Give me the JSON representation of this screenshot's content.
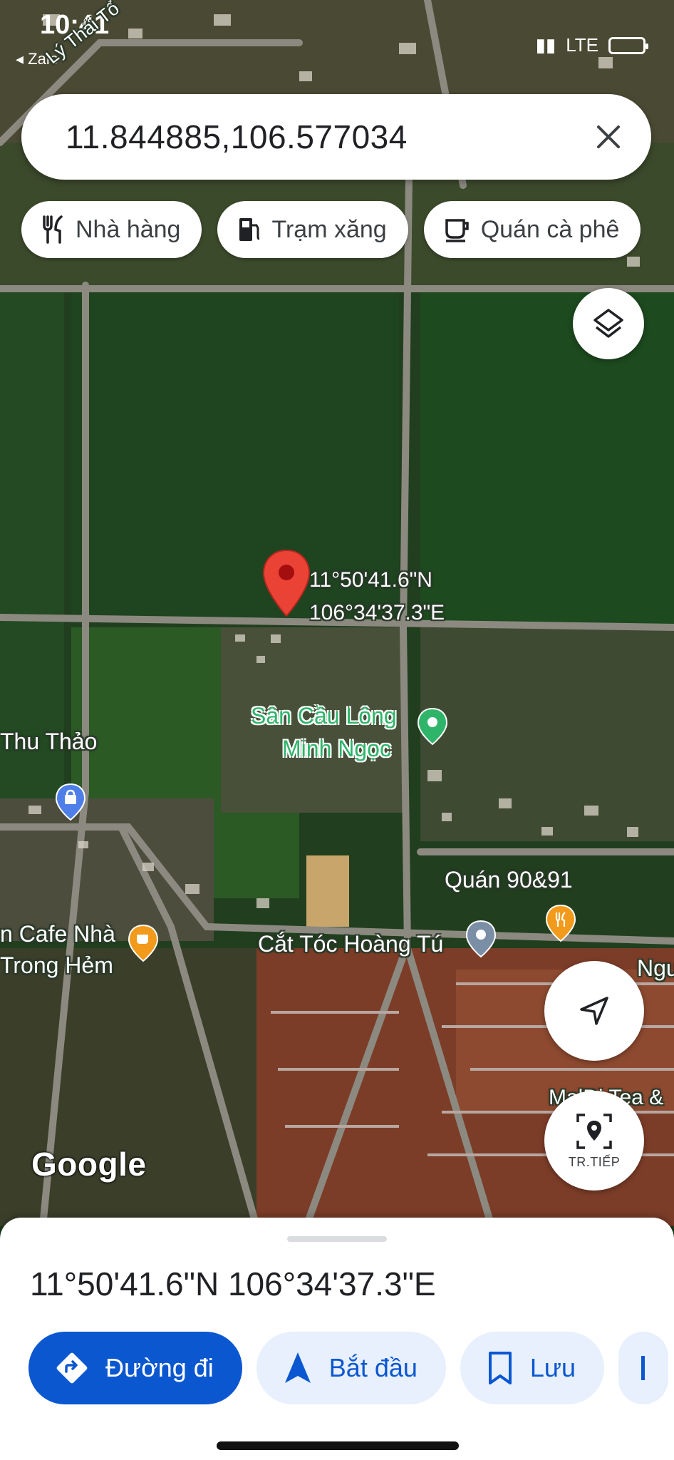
{
  "status_bar": {
    "time": "10:41",
    "back_app": "◂ Zalo",
    "network": "LTE"
  },
  "search": {
    "query": "11.844885,106.577034"
  },
  "chips": [
    {
      "label": "Nhà hàng",
      "icon": "restaurant-icon"
    },
    {
      "label": "Trạm xăng",
      "icon": "gas-station-icon"
    },
    {
      "label": "Quán cà phê",
      "icon": "coffee-icon"
    }
  ],
  "map": {
    "street_label": "Lý Thái Tổ",
    "pin_lat": "11°50'41.6\"N",
    "pin_lng": "106°34'37.3\"E",
    "places": [
      {
        "name_line1": "Sân Cầu Lông",
        "name_line2": "Minh Ngọc"
      },
      {
        "name_line1": "Thu Thảo"
      },
      {
        "name_line1": "n Cafe Nhà",
        "name_line2": "Trong Hẻm"
      },
      {
        "name_line1": "Quán 90&91"
      },
      {
        "name_line1": "Cắt Tóc Hoàng Tú"
      },
      {
        "name_line1": "Ngu"
      },
      {
        "name_line1": "MalDi Tea &"
      }
    ],
    "google_logo": "Google",
    "live_view_label": "TR.TIẾP"
  },
  "sheet": {
    "coordinates": "11°50'41.6\"N 106°34'37.3\"E",
    "actions": [
      {
        "label": "Đường đi",
        "icon": "directions-icon"
      },
      {
        "label": "Bắt đầu",
        "icon": "navigation-arrow-icon"
      },
      {
        "label": "Lưu",
        "icon": "bookmark-icon"
      }
    ]
  },
  "colors": {
    "accent": "#0b57d0",
    "pin": "#ea4335",
    "place_green": "#2fb56a"
  }
}
